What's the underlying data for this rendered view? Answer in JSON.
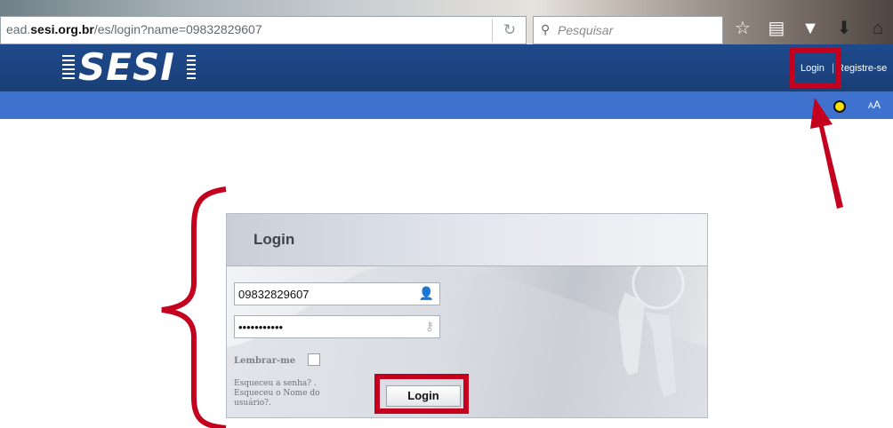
{
  "browser": {
    "url_prefix": "ead.",
    "url_domain": "sesi.org.br",
    "url_path": "/es/login?name=09832829607",
    "reload_icon": "reload-icon",
    "search_placeholder": "Pesquisar",
    "toolbar_icons": [
      "bookmark-star-icon",
      "reading-list-icon",
      "pocket-icon",
      "download-icon",
      "home-icon"
    ]
  },
  "header": {
    "logo_text": "SESI",
    "nav": {
      "login_label": "Login",
      "separator": "|",
      "register_label": "Registre-se"
    }
  },
  "accessibility": {
    "contrast_icon": "contrast-toggle-icon",
    "font_size_small": "A",
    "font_size_large": "A"
  },
  "login_form": {
    "title": "Login",
    "username_value": "09832829607",
    "password_value": "•••••••••••",
    "remember_label": "Lembrar-me",
    "forgot_password": "Esqueceu a senha? .",
    "forgot_username_1": "Esqueceu o Nome do",
    "forgot_username_2": "usuário?.",
    "submit_label": "Login"
  },
  "annotations": {
    "highlight_color": "#c4001f"
  },
  "colors": {
    "header_bg": "#1e4a8c",
    "subbar_bg": "#3f72cf"
  }
}
